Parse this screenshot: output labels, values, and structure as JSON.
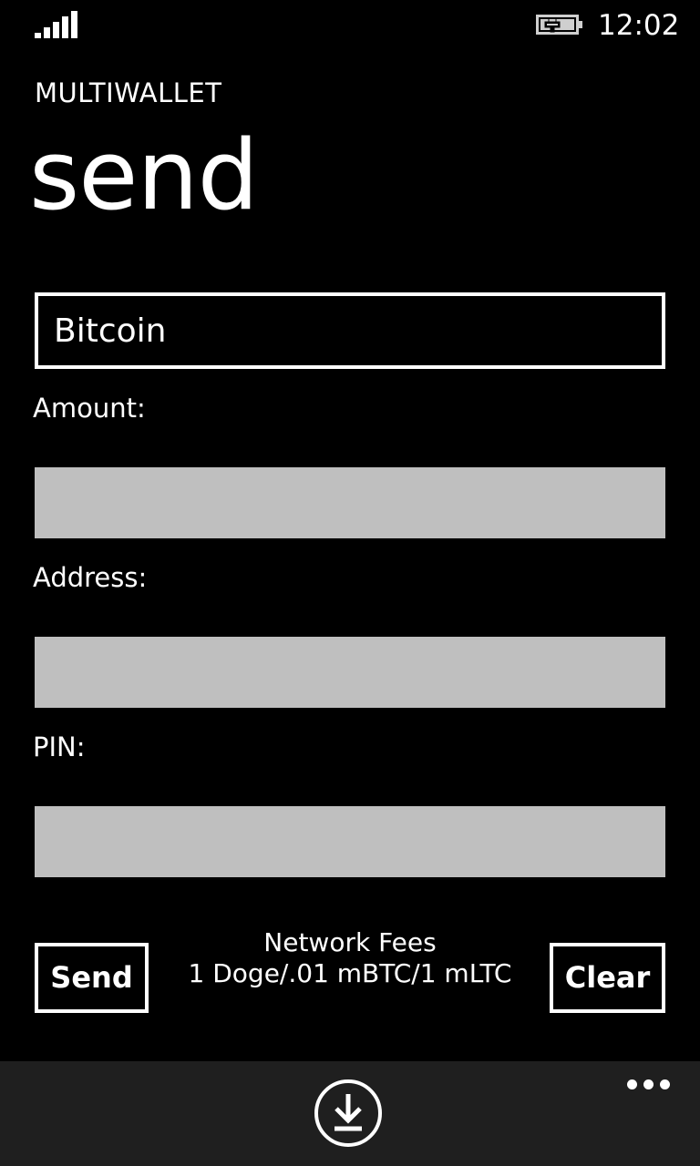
{
  "status_bar": {
    "time": "12:02",
    "signal_icon": "signal-strength-icon",
    "battery_icon": "battery-charging-icon"
  },
  "header": {
    "app_title": "MULTIWALLET",
    "page_title": "send"
  },
  "form": {
    "currency": {
      "selected": "Bitcoin"
    },
    "amount": {
      "label": "Amount:",
      "value": ""
    },
    "address": {
      "label": "Address:",
      "value": ""
    },
    "pin": {
      "label": "PIN:",
      "value": ""
    }
  },
  "actions": {
    "send_label": "Send",
    "clear_label": "Clear"
  },
  "fees": {
    "title": "Network Fees",
    "detail": "1 Doge/.01 mBTC/1 mLTC"
  },
  "app_bar": {
    "primary_icon": "download-icon",
    "more_icon": "ellipsis-icon"
  },
  "colors": {
    "background": "#000000",
    "foreground": "#ffffff",
    "input_fill": "#bfbfbf",
    "app_bar": "#1f1f1f"
  }
}
